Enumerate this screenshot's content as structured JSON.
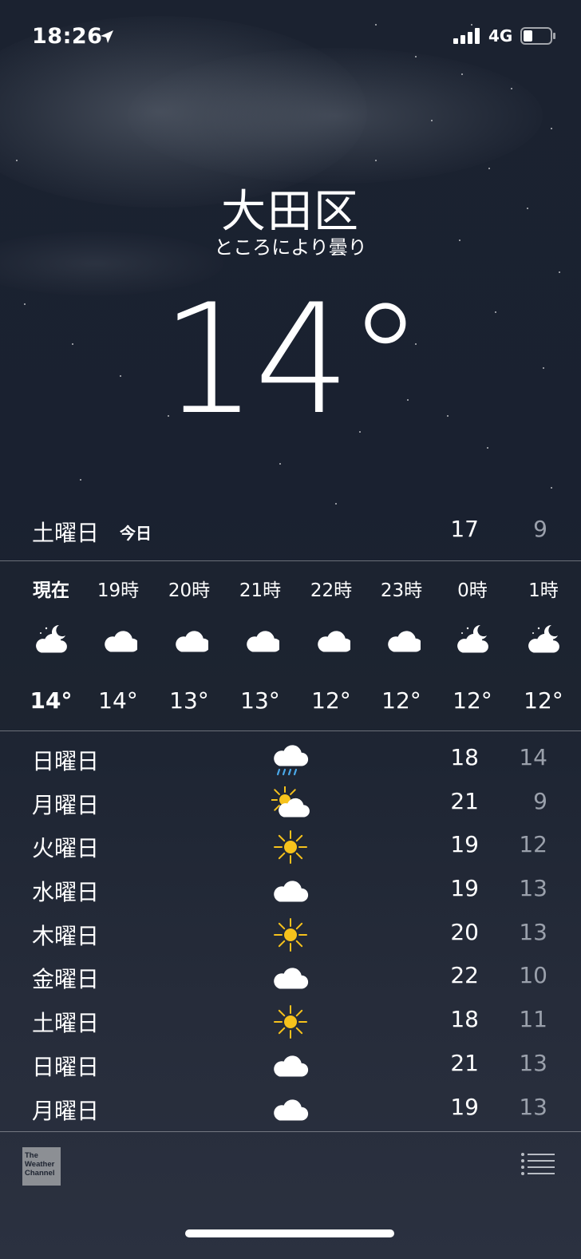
{
  "status_bar": {
    "time": "18:26",
    "network": "4G",
    "icons": [
      "location-arrow-icon",
      "signal-bars-icon",
      "battery-icon"
    ]
  },
  "location": {
    "city": "大田区",
    "condition": "ところにより曇り",
    "temperature": "14°"
  },
  "today": {
    "day": "土曜日",
    "label": "今日",
    "high": "17",
    "low": "9"
  },
  "hourly": [
    {
      "time": "現在",
      "icon": "partly-cloudy-night-icon",
      "temp": "14°"
    },
    {
      "time": "19時",
      "icon": "cloud-icon",
      "temp": "14°"
    },
    {
      "time": "20時",
      "icon": "cloud-icon",
      "temp": "13°"
    },
    {
      "time": "21時",
      "icon": "cloud-icon",
      "temp": "13°"
    },
    {
      "time": "22時",
      "icon": "cloud-icon",
      "temp": "12°"
    },
    {
      "time": "23時",
      "icon": "cloud-icon",
      "temp": "12°"
    },
    {
      "time": "0時",
      "icon": "partly-cloudy-night-icon",
      "temp": "12°"
    },
    {
      "time": "1時",
      "icon": "partly-cloudy-night-icon",
      "temp": "12°"
    }
  ],
  "daily": [
    {
      "day": "日曜日",
      "icon": "rain-icon",
      "high": "18",
      "low": "14"
    },
    {
      "day": "月曜日",
      "icon": "partly-sunny-icon",
      "high": "21",
      "low": "9"
    },
    {
      "day": "火曜日",
      "icon": "sun-icon",
      "high": "19",
      "low": "12"
    },
    {
      "day": "水曜日",
      "icon": "cloud-icon",
      "high": "19",
      "low": "13"
    },
    {
      "day": "木曜日",
      "icon": "sun-icon",
      "high": "20",
      "low": "13"
    },
    {
      "day": "金曜日",
      "icon": "cloud-icon",
      "high": "22",
      "low": "10"
    },
    {
      "day": "土曜日",
      "icon": "sun-icon",
      "high": "18",
      "low": "11"
    },
    {
      "day": "日曜日",
      "icon": "cloud-icon",
      "high": "21",
      "low": "13"
    },
    {
      "day": "月曜日",
      "icon": "cloud-icon",
      "high": "19",
      "low": "13"
    }
  ],
  "footer": {
    "logo_line1": "The",
    "logo_line2": "Weather",
    "logo_line3": "Channel"
  },
  "colors": {
    "sun": "#f6c21c",
    "rain": "#4aa8e8",
    "low_temp": "#9aa0ab"
  }
}
